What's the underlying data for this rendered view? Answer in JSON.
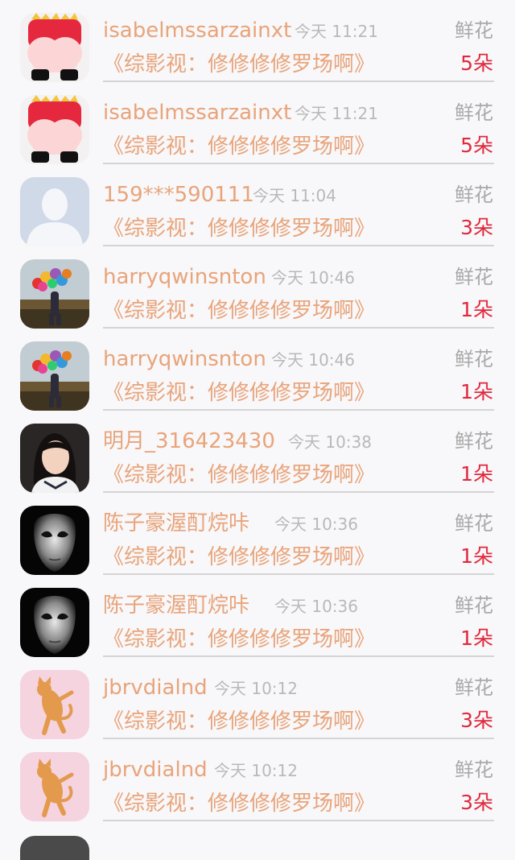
{
  "colors": {
    "name": "#e8a47a",
    "time": "#b9b9b9",
    "gift_label": "#a9a9a9",
    "count": "#e0293d",
    "divider": "#d4d4d4",
    "background": "#f8f7f9"
  },
  "items": [
    {
      "name": "isabelmssarzainxt",
      "time": "今天 11:21",
      "gift": "鲜花",
      "title": "《综影视：修修修修罗场啊》",
      "count": "5朵",
      "avatar": "cartoon-character-avatar"
    },
    {
      "name": "isabelmssarzainxt",
      "time": "今天 11:21",
      "gift": "鲜花",
      "title": "《综影视：修修修修罗场啊》",
      "count": "5朵",
      "avatar": "cartoon-character-avatar"
    },
    {
      "name": "159***590111",
      "time": "今天 11:04",
      "gift": "鲜花",
      "title": "《综影视：修修修修罗场啊》",
      "count": "3朵",
      "avatar": "default-person-avatar"
    },
    {
      "name": "harryqwinsnton",
      "time": "今天 10:46",
      "gift": "鲜花",
      "title": "《综影视：修修修修罗场啊》",
      "count": "1朵",
      "avatar": "balloons-avatar"
    },
    {
      "name": "harryqwinsnton",
      "time": "今天 10:46",
      "gift": "鲜花",
      "title": "《综影视：修修修修罗场啊》",
      "count": "1朵",
      "avatar": "balloons-avatar"
    },
    {
      "name": "明月_316423430",
      "time": "今天 10:38",
      "gift": "鲜花",
      "title": "《综影视：修修修修罗场啊》",
      "count": "1朵",
      "avatar": "girl-photo-avatar"
    },
    {
      "name": "陈子豪渥酊烷咔",
      "time": "今天 10:36",
      "gift": "鲜花",
      "title": "《综影视：修修修修罗场啊》",
      "count": "1朵",
      "avatar": "mask-avatar"
    },
    {
      "name": "陈子豪渥酊烷咔",
      "time": "今天 10:36",
      "gift": "鲜花",
      "title": "《综影视：修修修修罗场啊》",
      "count": "1朵",
      "avatar": "mask-avatar"
    },
    {
      "name": "jbrvdialnd",
      "time": "今天 10:12",
      "gift": "鲜花",
      "title": "《综影视：修修修修罗场啊》",
      "count": "3朵",
      "avatar": "cat-avatar"
    },
    {
      "name": "jbrvdialnd",
      "time": "今天 10:12",
      "gift": "鲜花",
      "title": "《综影视：修修修修罗场啊》",
      "count": "3朵",
      "avatar": "cat-avatar"
    }
  ]
}
